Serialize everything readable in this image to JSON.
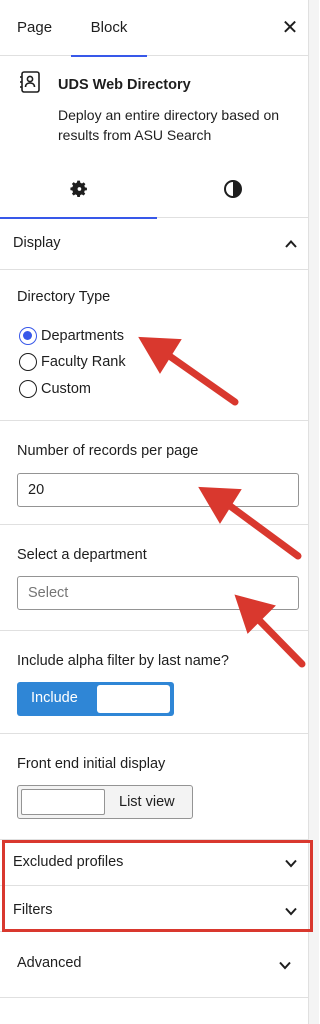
{
  "tabs": {
    "page": "Page",
    "block": "Block"
  },
  "block": {
    "title": "UDS Web Directory",
    "description": "Deploy an entire directory based on results from ASU Search"
  },
  "style_tabs": {
    "settings_icon": "gear-icon",
    "styles_icon": "half-circle-contrast-icon"
  },
  "display_panel": {
    "title": "Display",
    "directory_type": {
      "label": "Directory Type",
      "options": [
        "Departments",
        "Faculty Rank",
        "Custom"
      ],
      "selected": "Departments"
    },
    "records_per_page": {
      "label": "Number of records per page",
      "value": "20"
    },
    "department": {
      "label": "Select a department",
      "placeholder": "Select"
    },
    "alpha_filter": {
      "label": "Include alpha filter by last name?",
      "option": "Include"
    },
    "initial_display": {
      "label": "Front end initial display",
      "option": "List view"
    }
  },
  "collapsed_panels": [
    "Excluded profiles",
    "Filters",
    "Advanced"
  ],
  "colors": {
    "accent": "#3858e9",
    "toggle": "#2f86d6",
    "annotation": "#d9382e"
  }
}
